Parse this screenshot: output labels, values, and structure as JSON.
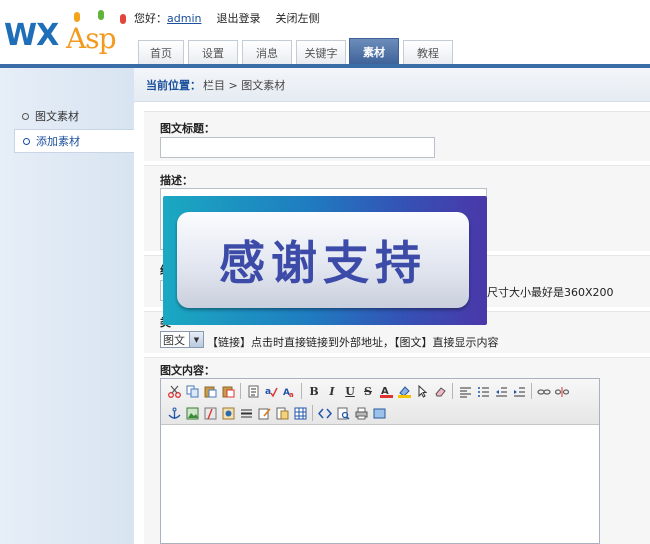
{
  "logo": {
    "primary": "WX",
    "secondary": "Asp"
  },
  "topbar": {
    "greeting": "您好：",
    "username": "admin",
    "logout": "退出登录",
    "close_left": "关闭左侧"
  },
  "tabs": [
    {
      "label": "首页"
    },
    {
      "label": "设置"
    },
    {
      "label": "消息"
    },
    {
      "label": "关键字"
    },
    {
      "label": "素材",
      "active": true
    },
    {
      "label": "教程"
    }
  ],
  "sidebar": {
    "items": [
      {
        "label": "图文素材"
      },
      {
        "label": "添加素材",
        "active": true
      }
    ]
  },
  "breadcrumb": {
    "label": "当前位置：",
    "path": "栏目 > 图文素材"
  },
  "form": {
    "title_label": "图文标题：",
    "title_value": "",
    "desc_label": "描述：",
    "desc_value": "",
    "image_label_partial": "缩",
    "image_hint_partial": "尺寸大小最好是360X200",
    "type_label_partial": "类",
    "type_select_value": "图文",
    "type_hint": "【链接】点击时直接链接到外部地址，【图文】直接显示内容",
    "content_label": "图文内容："
  },
  "editor": {
    "toolbar_row1": [
      "cut-icon",
      "copy-icon",
      "paste-icon",
      "paste-text-icon",
      "sep",
      "paste-word-icon",
      "spellcheck-icon",
      "find-replace-icon",
      "sep",
      "bold-icon",
      "italic-icon",
      "underline-icon",
      "strike-icon",
      "font-color-icon",
      "bg-color-icon",
      "select-icon",
      "eraser-icon",
      "sep",
      "align-left-icon",
      "list-icon",
      "outdent-icon",
      "indent-icon",
      "sep",
      "link-icon",
      "unlink-icon"
    ],
    "toolbar_row2": [
      "anchor-icon",
      "image-icon",
      "flash-icon",
      "media-icon",
      "hr-icon",
      "form-icon",
      "template-icon",
      "table-icon",
      "sep",
      "source-icon",
      "preview-icon",
      "print-icon",
      "fullscreen-icon"
    ]
  },
  "overlay": {
    "text": "感谢支持"
  },
  "colors": {
    "accent": "#3a6da8",
    "tab_active": "#4a6ea3",
    "link": "#1a4f9c",
    "logo_blue": "#1e6fb8",
    "logo_orange": "#f29a1d"
  }
}
